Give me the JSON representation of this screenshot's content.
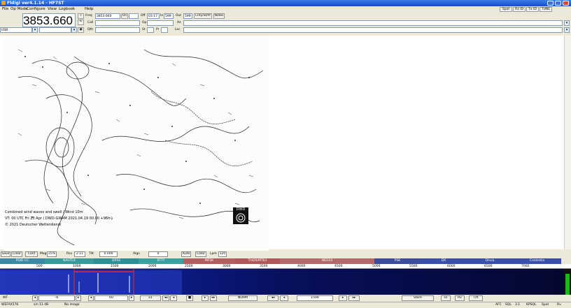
{
  "window": {
    "title": "Fldigi ver4.1.14 - HF7ST"
  },
  "menu": {
    "items": [
      "File",
      "Op Mode",
      "Configure",
      "View",
      "Logbook",
      "Help"
    ],
    "right_buttons": [
      "Spot",
      "Rx ID",
      "Tx ID",
      "TUNE"
    ]
  },
  "frequency": {
    "display": "3853.660"
  },
  "mode": {
    "selected": "USB"
  },
  "qso": {
    "freq_label": "Freq",
    "freq_value": "3853.660",
    "on_label": "On",
    "off_label": "Off",
    "off_value": "03:17",
    "in_label": "In",
    "in_value": "599",
    "out_label": "Out",
    "out_value": "599",
    "cnty_label": "Cnty/St/Pr",
    "notes_label": "Notes",
    "call_label": "Call",
    "op_label": "Op",
    "az_label": "Az",
    "qth_label": "Qth",
    "st_label": "St",
    "pr_label": "Pr",
    "loc_label": "Loc"
  },
  "fax": {
    "caption_line1": "Combined wind waves and swell / Wind 10m",
    "caption_line2": "VT:  00 UTC Fri 23 Apr ( DWD-GWAM 2021.04.19 00.00  +96h )",
    "caption_line3": "© 2021 Deutscher Wetterdienst",
    "logo_text": "DWD"
  },
  "bottom_buttons": {
    "save": "Save",
    "clear": "Clear",
    "config": "Conf",
    "mag": "Mag",
    "mag_value": "25%",
    "rsv": "Rsv",
    "rsv_value": "2.11",
    "tilt": "Tilt",
    "tilt_value": "0.000",
    "align": "Algn",
    "align_value": "0",
    "auto": "Auto",
    "color": "Color",
    "lpm": "Lpm",
    "lpm_value": "120"
  },
  "bands": [
    {
      "label": "RSID CC",
      "color": "#3a8aa6"
    },
    {
      "label": "NAVTEX",
      "color": "#3a9a9a"
    },
    {
      "label": "QRSS",
      "color": "#2e8e98"
    },
    {
      "label": "RTTY",
      "color": "#3aa0a0"
    },
    {
      "label": "MFSK",
      "color": "#b06060"
    },
    {
      "label": "THOR/MT63",
      "color": "#b05858"
    },
    {
      "label": "WEFAX",
      "color": "#b06a6a"
    },
    {
      "label": "PSK",
      "color": "#3a4c9a"
    },
    {
      "label": "DX",
      "color": "#3a50a6"
    },
    {
      "label": "Olivia",
      "color": "#3a50a6"
    },
    {
      "label": "Contestia",
      "color": "#3a50a6"
    }
  ],
  "scale_ticks": [
    "500",
    "1000",
    "1500",
    "2000",
    "2500",
    "3000",
    "3500",
    "4000",
    "4500",
    "5000",
    "5500",
    "6000",
    "6500",
    "7000"
  ],
  "waterfall_controls": {
    "wf_label": "WF",
    "fft_value": "-6",
    "range_value": "60",
    "x1_label": "x1",
    "norm_label": "NORM",
    "rate_value": "1500",
    "store_label": "Store",
    "lk_label": "Lk",
    "rv_label": "Rv",
    "tx_label": "T/R"
  },
  "status": {
    "mode": "WEFAX576",
    "s_n": "s/n  11 dB",
    "image_info": "No image",
    "afc": "AFC",
    "sql": "SQL",
    "value": "3.1",
    "kpsql": "KPSQL",
    "spot": "Spot",
    "rv": "Rv"
  }
}
